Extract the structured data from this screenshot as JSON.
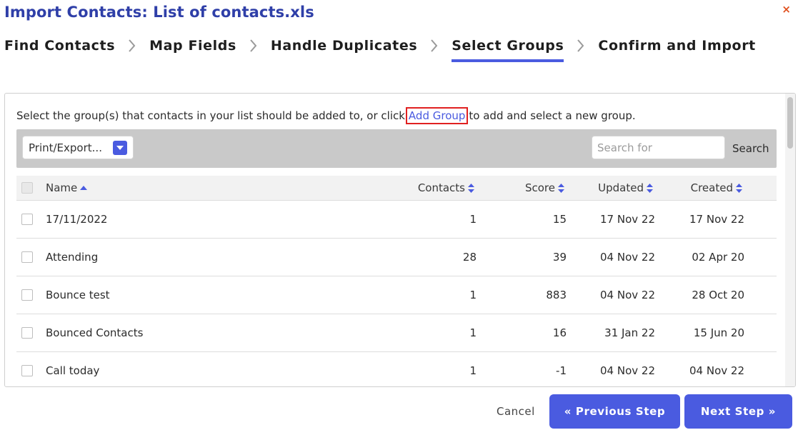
{
  "dialog": {
    "title": "Import Contacts: List of contacts.xls",
    "close_glyph": "×"
  },
  "steps": [
    {
      "label": "Find Contacts",
      "active": false
    },
    {
      "label": "Map Fields",
      "active": false
    },
    {
      "label": "Handle Duplicates",
      "active": false
    },
    {
      "label": "Select Groups",
      "active": true
    },
    {
      "label": "Confirm and Import",
      "active": false
    }
  ],
  "intro": {
    "before": "Select the group(s) that contacts in your list should be added to, or click",
    "link": "Add Group",
    "after": "to add and select a new group."
  },
  "toolbar": {
    "export_label": "Print/Export...",
    "search_placeholder": "Search for",
    "search_button": "Search"
  },
  "table": {
    "headers": {
      "name": "Name",
      "contacts": "Contacts",
      "score": "Score",
      "updated": "Updated",
      "created": "Created"
    },
    "rows": [
      {
        "name": "17/11/2022",
        "contacts": "1",
        "score": "15",
        "updated": "17 Nov 22",
        "created": "17 Nov 22"
      },
      {
        "name": "Attending",
        "contacts": "28",
        "score": "39",
        "updated": "04 Nov 22",
        "created": "02 Apr 20"
      },
      {
        "name": "Bounce test",
        "contacts": "1",
        "score": "883",
        "updated": "04 Nov 22",
        "created": "28 Oct 20"
      },
      {
        "name": "Bounced Contacts",
        "contacts": "1",
        "score": "16",
        "updated": "31 Jan 22",
        "created": "15 Jun 20"
      },
      {
        "name": "Call today",
        "contacts": "1",
        "score": "-1",
        "updated": "04 Nov 22",
        "created": "04 Nov 22"
      }
    ]
  },
  "footer": {
    "cancel": "Cancel",
    "previous": "« Previous Step",
    "next": "Next Step »"
  },
  "colors": {
    "accent": "#4a5be0",
    "title": "#2f3fa8",
    "close": "#e0501e",
    "highlight_border": "#e02020"
  }
}
